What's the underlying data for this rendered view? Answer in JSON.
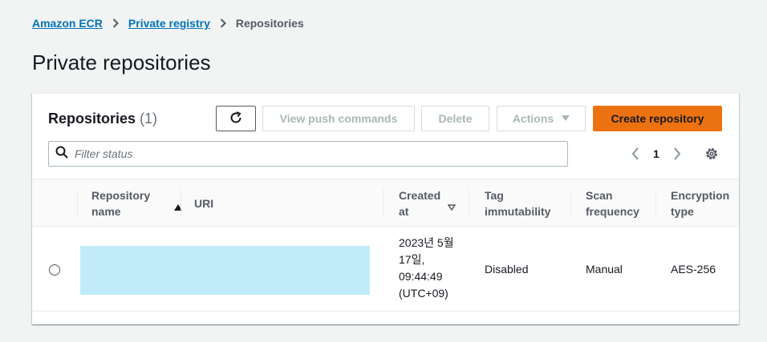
{
  "breadcrumb": {
    "items": [
      "Amazon ECR",
      "Private registry"
    ],
    "current": "Repositories"
  },
  "page": {
    "title": "Private repositories"
  },
  "card": {
    "title": "Repositories",
    "count": "(1)"
  },
  "toolbar": {
    "view_push_label": "View push commands",
    "delete_label": "Delete",
    "actions_label": "Actions",
    "create_label": "Create repository"
  },
  "search": {
    "placeholder": "Filter status"
  },
  "pagination": {
    "current_page": "1"
  },
  "table": {
    "headers": {
      "name": "Repository name",
      "uri": "URI",
      "created": "Created at",
      "tag": "Tag immutability",
      "scan": "Scan frequency",
      "encryption": "Encryption type"
    },
    "rows": [
      {
        "created": "2023년 5월 17일, 09:44:49 (UTC+09)",
        "tag": "Disabled",
        "scan": "Manual",
        "encryption": "AES-256"
      }
    ]
  },
  "colors": {
    "link": "#0073bb",
    "primary": "#ec7211",
    "redaction": "#c2ebfa",
    "background": "#f2f3f3"
  }
}
